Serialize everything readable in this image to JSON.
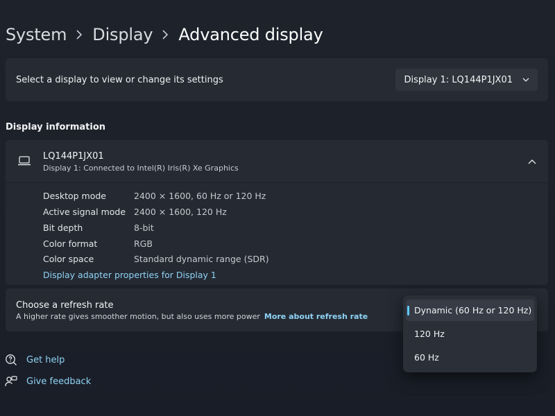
{
  "breadcrumb": {
    "items": [
      "System",
      "Display",
      "Advanced display"
    ]
  },
  "select_display": {
    "label": "Select a display to view or change its settings",
    "dropdown_value": "Display 1: LQ144P1JX01",
    "dropdown_icon": "chevron-down-icon"
  },
  "display_information": {
    "section_title": "Display information",
    "header": {
      "icon": "laptop-icon",
      "title": "LQ144P1JX01",
      "subtitle": "Display 1: Connected to Intel(R) Iris(R) Xe Graphics",
      "toggle_icon": "chevron-up-icon"
    },
    "rows": [
      {
        "key": "Desktop mode",
        "value": "2400 × 1600, 60 Hz or 120 Hz"
      },
      {
        "key": "Active signal mode",
        "value": "2400 × 1600, 120 Hz"
      },
      {
        "key": "Bit depth",
        "value": "8-bit"
      },
      {
        "key": "Color format",
        "value": "RGB"
      },
      {
        "key": "Color space",
        "value": "Standard dynamic range (SDR)"
      }
    ],
    "adapter_link": "Display adapter properties for Display 1"
  },
  "refresh_rate": {
    "title": "Choose a refresh rate",
    "description": "A higher rate gives smoother motion, but also uses more power",
    "link": "More about refresh rate",
    "options": [
      {
        "label": "Dynamic (60 Hz or 120 Hz)",
        "selected": true
      },
      {
        "label": "120 Hz",
        "selected": false
      },
      {
        "label": "60 Hz",
        "selected": false
      }
    ]
  },
  "footer": {
    "get_help": "Get help",
    "give_feedback": "Give feedback"
  },
  "colors": {
    "background": "#1b2028",
    "card": "#252a33",
    "link": "#8fd3f5",
    "accent": "#60cdff"
  }
}
